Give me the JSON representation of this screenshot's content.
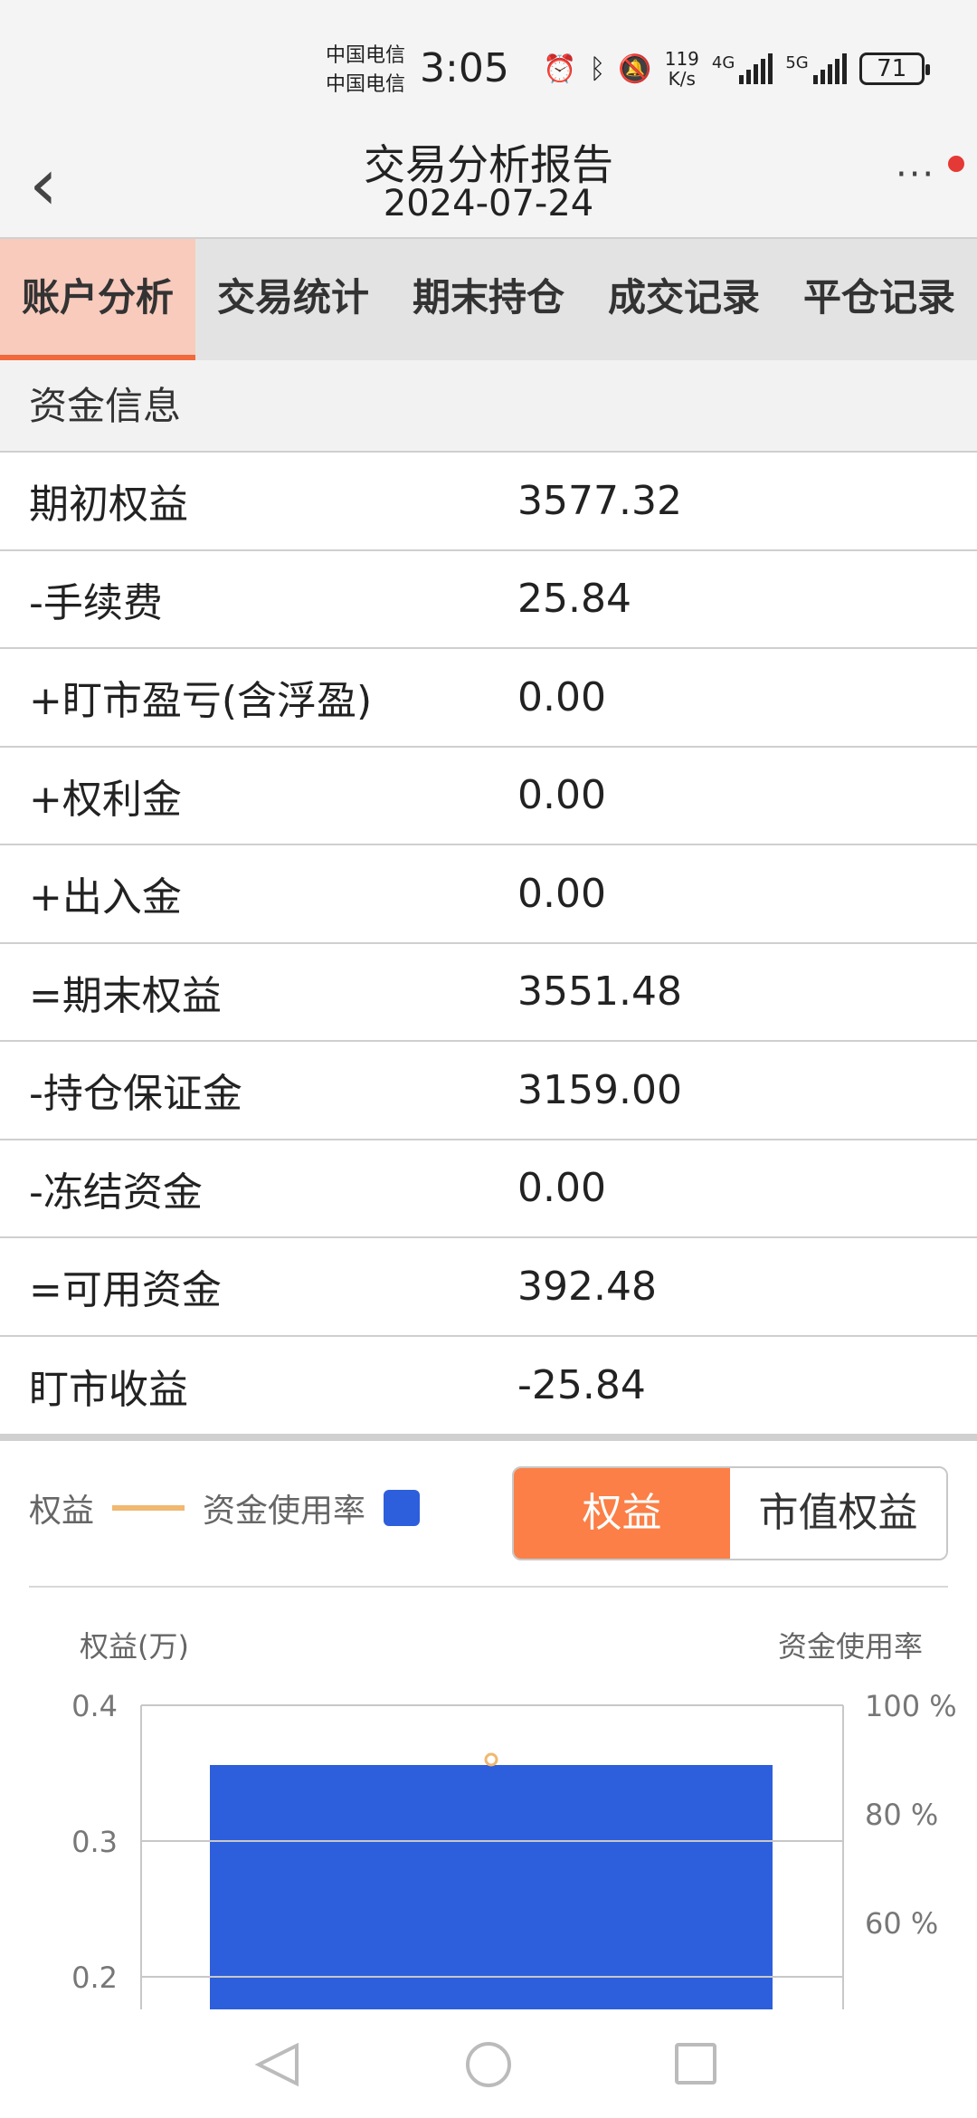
{
  "status_bar": {
    "carrier_1": "中国电信",
    "carrier_2": "中国电信",
    "time": "3:05",
    "net_speed_value": "119",
    "net_speed_unit": "K/s",
    "sim1_type": "4G",
    "sim2_type": "5G",
    "battery": "71",
    "icons": [
      "alarm-icon",
      "bluetooth-icon",
      "mute-icon",
      "signal-icon",
      "battery-icon"
    ]
  },
  "header": {
    "title": "交易分析报告",
    "date": "2024-07-24",
    "more": "···"
  },
  "tabs": [
    {
      "label": "账户分析",
      "active": true
    },
    {
      "label": "交易统计",
      "active": false
    },
    {
      "label": "期末持仓",
      "active": false
    },
    {
      "label": "成交记录",
      "active": false
    },
    {
      "label": "平仓记录",
      "active": false
    }
  ],
  "fund_section": {
    "title": "资金信息",
    "rows": [
      {
        "label": "期初权益",
        "value": "3577.32"
      },
      {
        "label": "-手续费",
        "value": "25.84"
      },
      {
        "label": "+盯市盈亏(含浮盈)",
        "value": "0.00"
      },
      {
        "label": "+权利金",
        "value": "0.00"
      },
      {
        "label": "+出入金",
        "value": "0.00"
      },
      {
        "label": "=期末权益",
        "value": "3551.48"
      },
      {
        "label": "-持仓保证金",
        "value": "3159.00"
      },
      {
        "label": "-冻结资金",
        "value": "0.00"
      },
      {
        "label": "=可用资金",
        "value": "392.48"
      },
      {
        "label": "盯市收益",
        "value": "-25.84"
      }
    ]
  },
  "legend": {
    "equity": "权益",
    "usage": "资金使用率",
    "equity_color": "#f0b870",
    "usage_color": "#2d5fdc"
  },
  "toggle": {
    "option_1": "权益",
    "option_2": "市值权益",
    "active_color": "#fb7f46"
  },
  "chart_data": {
    "type": "bar",
    "ylabel": "权益(万)",
    "y2label": "资金使用率",
    "y_ticks": [
      "0.4",
      "0.3",
      "0.2"
    ],
    "y2_ticks": [
      "100 %",
      "80 %",
      "60 %"
    ],
    "ylim_visible": [
      0.2,
      0.4
    ],
    "y2lim_visible": [
      0.6,
      1.0
    ],
    "series": [
      {
        "name": "权益",
        "kind": "line",
        "color": "#f0b870",
        "values": [
          0.36
        ]
      },
      {
        "name": "资金使用率",
        "kind": "bar",
        "color": "#2d5fdc",
        "values": [
          0.89
        ]
      }
    ]
  }
}
